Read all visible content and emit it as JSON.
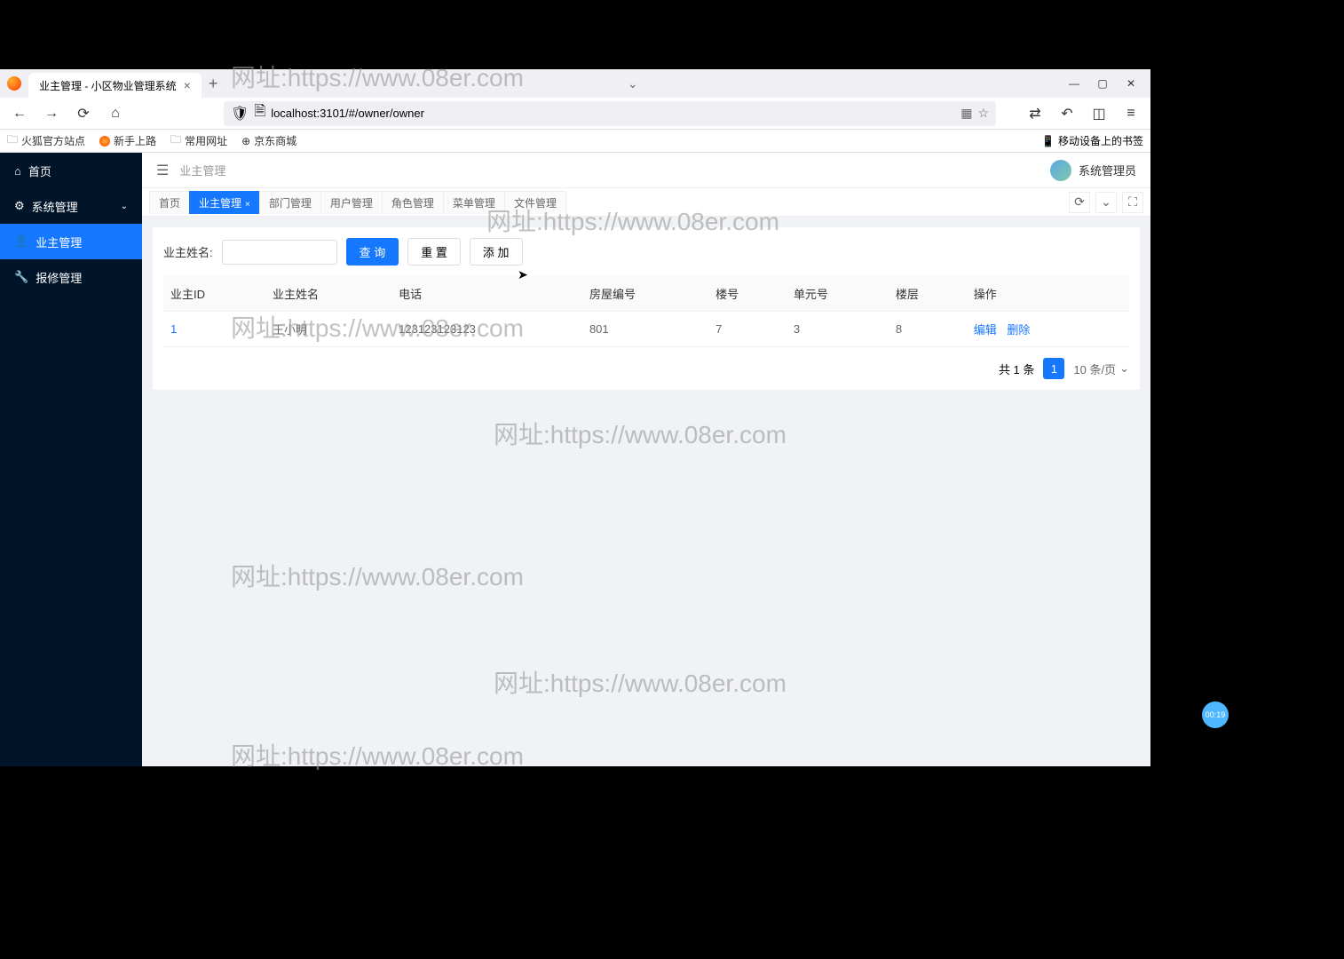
{
  "browser": {
    "tab_title": "业主管理 - 小区物业管理系统",
    "url": "localhost:3101/#/owner/owner",
    "bookmarks": [
      "火狐官方站点",
      "新手上路",
      "常用网址",
      "京东商城"
    ],
    "mobile_bookmarks": "移动设备上的书签"
  },
  "sidebar": {
    "items": [
      {
        "label": "首页"
      },
      {
        "label": "系统管理"
      },
      {
        "label": "业主管理"
      },
      {
        "label": "报修管理"
      }
    ]
  },
  "header": {
    "breadcrumb": "业主管理",
    "username": "系统管理员"
  },
  "tabs": [
    "首页",
    "业主管理",
    "部门管理",
    "用户管理",
    "角色管理",
    "菜单管理",
    "文件管理"
  ],
  "search": {
    "label": "业主姓名:",
    "query_btn": "查 询",
    "reset_btn": "重 置",
    "add_btn": "添 加"
  },
  "table": {
    "headers": [
      "业主ID",
      "业主姓名",
      "电话",
      "房屋编号",
      "楼号",
      "单元号",
      "楼层",
      "操作"
    ],
    "rows": [
      {
        "id": "1",
        "name": "王小明",
        "phone": "123123123123",
        "room": "801",
        "building": "7",
        "unit": "3",
        "floor": "8"
      }
    ],
    "actions": {
      "edit": "编辑",
      "delete": "删除"
    }
  },
  "pagination": {
    "total_text": "共 1 条",
    "current": "1",
    "size_text": "10 条/页"
  },
  "watermark": "网址:https://www.08er.com",
  "timer": "00:19"
}
